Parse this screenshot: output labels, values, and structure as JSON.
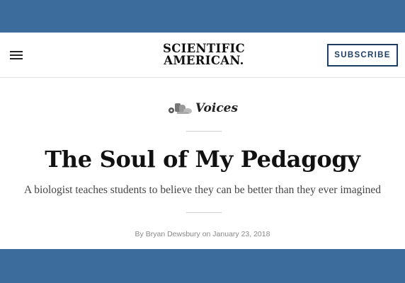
{
  "header": {
    "menu_icon": "hamburger-menu-icon",
    "logo_line1": "SCIENTIFIC",
    "logo_line2": "AMERICAN.",
    "subscribe_label": "SUBSCRIBE"
  },
  "article": {
    "section_icon": "voices-icon",
    "section": "Voices",
    "title": "The Soul of My Pedagogy",
    "subtitle": "A biologist teaches students to believe they can be better than they ever imagined",
    "byline_prefix": "By",
    "author": "Bryan Dewsbury",
    "byline_on": "on",
    "date": "January 23, 2018"
  },
  "colors": {
    "band": "#3b6c9b",
    "subscribe_border": "#1f3e67",
    "text_dark": "#111111",
    "byline_gray": "#888888"
  }
}
